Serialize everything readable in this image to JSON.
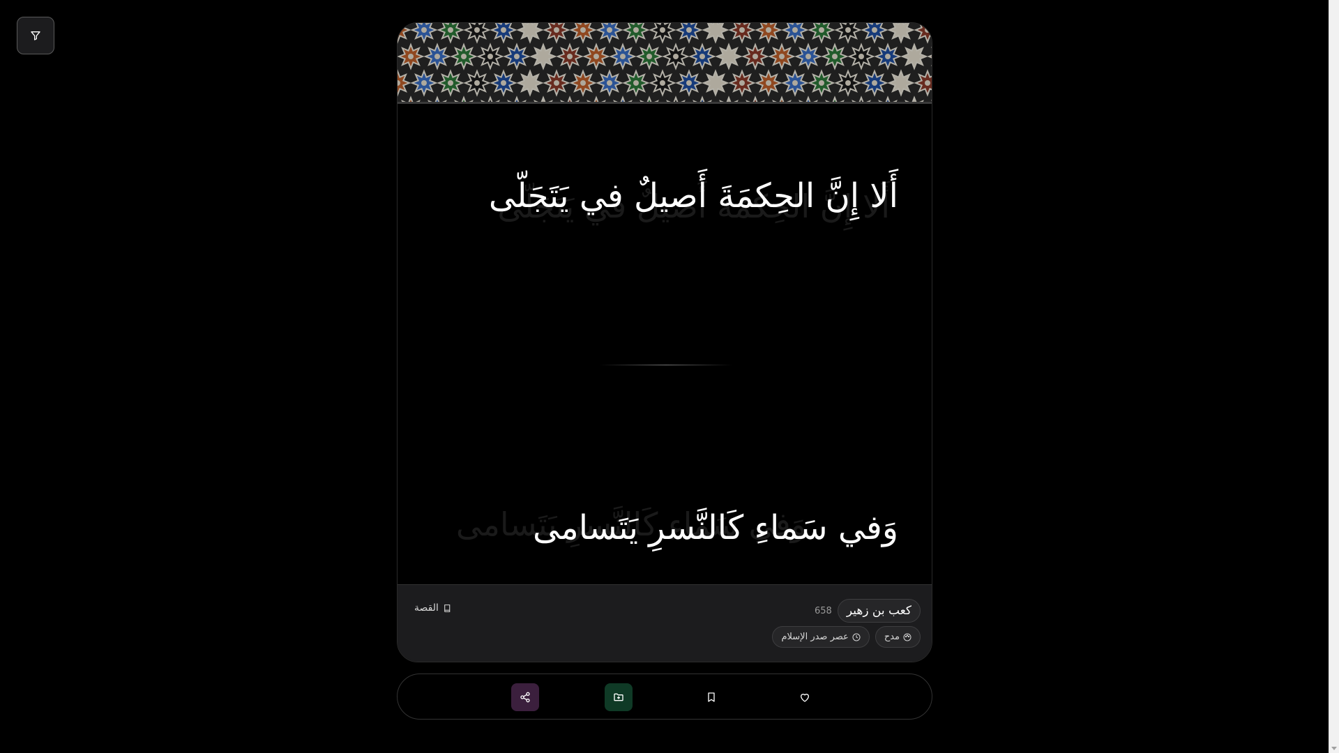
{
  "verse": {
    "first_hemistich": "أَلا إِنَّ الحِكمَةَ أَصيلٌ في يَتَجَلّى",
    "second_hemistich": "وَفي سَماءِ كَالنَّسرِ يَتَسامى"
  },
  "info": {
    "poet": "كعب بن زهير",
    "count": "658",
    "story_label": "القصة",
    "tags": [
      {
        "label": "مدح",
        "icon": "palette-icon"
      },
      {
        "label": "عصر صدر الإسلام",
        "icon": "clock-icon"
      }
    ]
  },
  "actions": {
    "share": {
      "icon": "share-icon",
      "color": "#3b1f3d"
    },
    "add_to_collection": {
      "icon": "folder-plus-icon",
      "color": "#0f3a26"
    },
    "bookmark": {
      "icon": "bookmark-icon"
    },
    "like": {
      "icon": "heart-icon"
    }
  },
  "colors": {
    "background": "#000000",
    "panel": "#1c1c1e",
    "pill": "#262628"
  }
}
